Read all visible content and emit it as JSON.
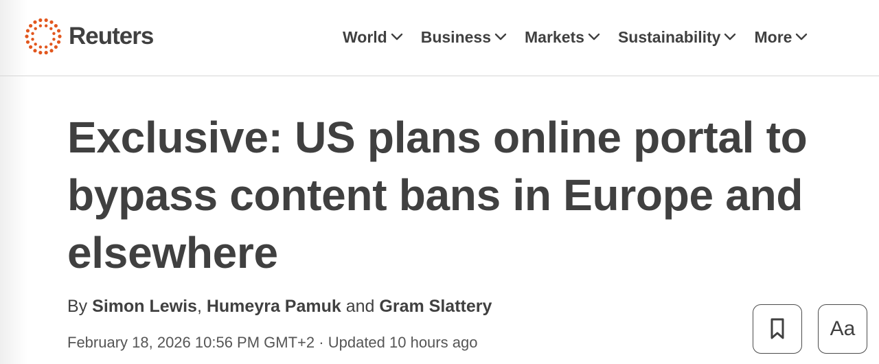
{
  "brand": {
    "name": "Reuters",
    "accent_color": "#e2571e"
  },
  "nav": {
    "items": [
      {
        "label": "World"
      },
      {
        "label": "Business"
      },
      {
        "label": "Markets"
      },
      {
        "label": "Sustainability"
      },
      {
        "label": "More"
      }
    ]
  },
  "article": {
    "headline": "Exclusive: US plans online portal to bypass content bans in Europe and elsewhere",
    "byline": {
      "prefix": "By",
      "authors": [
        "Simon Lewis",
        "Humeyra Pamuk",
        "Gram Slattery"
      ],
      "separator": ",",
      "conjunction": "and"
    },
    "dateline": {
      "published": "February 18, 2026 10:56 PM GMT+2",
      "separator": "·",
      "updated": "Updated 10 hours ago"
    }
  },
  "actions": {
    "bookmark_icon": "bookmark-icon",
    "font_size_label": "Aa"
  }
}
